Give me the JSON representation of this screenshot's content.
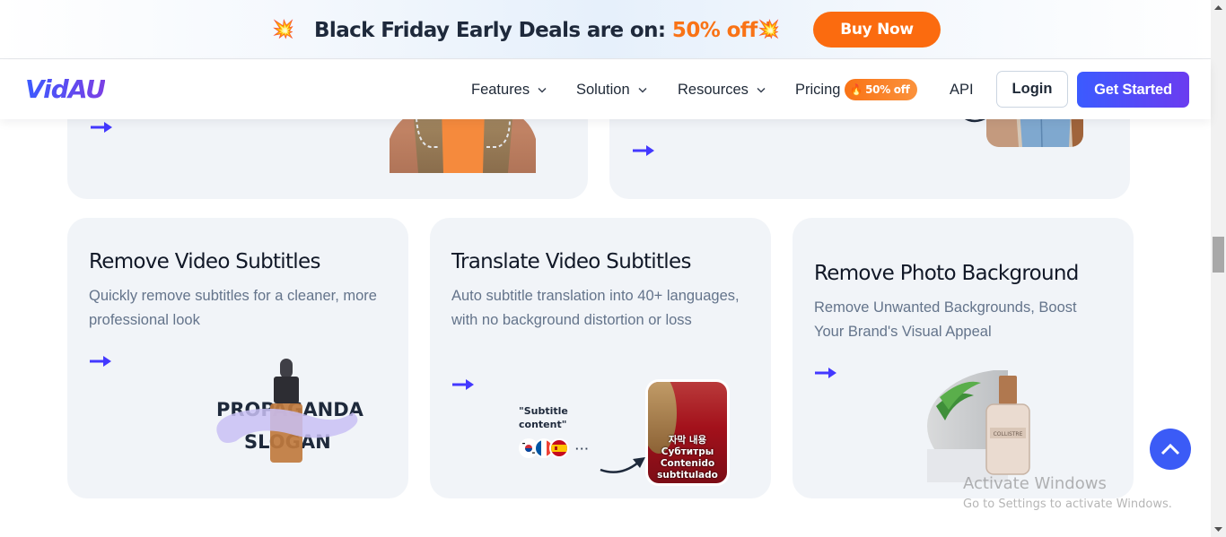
{
  "promo": {
    "icon": "collision-burst-icon",
    "headline": "Black Friday Early Deals are on: ",
    "headline_accent": "50% off !",
    "buy_button": "Buy Now",
    "accent_color": "#f97316",
    "button_color": "#fb6b0f"
  },
  "nav": {
    "logo": "VidAU",
    "items": [
      {
        "label": "Features",
        "has_dropdown": true
      },
      {
        "label": "Solution",
        "has_dropdown": true
      },
      {
        "label": "Resources",
        "has_dropdown": true
      },
      {
        "label": "Pricing",
        "badge": "50% off",
        "badge_icon": "flame-icon"
      },
      {
        "label": "API"
      }
    ],
    "login": "Login",
    "get_started": "Get Started",
    "brand_color": "#3b5bff"
  },
  "cards": {
    "top_left": {
      "arrow": "arrow-right-icon"
    },
    "top_right": {
      "arrow": "arrow-right-icon"
    },
    "remove_subtitles": {
      "title": "Remove Video Subtitles",
      "description": "Quickly remove subtitles for a cleaner, more professional look",
      "image_text_1": "PROPAGANDA",
      "image_text_2": "SLOGAN"
    },
    "translate_subtitles": {
      "title": "Translate Video Subtitles",
      "description": "Auto subtitle translation into 40+ languages, with no background distortion or loss",
      "quote": "\"Subtitle content\"",
      "flags": [
        "korea",
        "france",
        "spain"
      ],
      "more": "···",
      "translations": [
        "자막 내용",
        "Субтитры",
        "Contenido",
        "subtitulado"
      ]
    },
    "remove_photo_bg": {
      "title": "Remove Photo Background",
      "description": "Remove Unwanted Backgrounds, Boost Your Brand's Visual Appeal",
      "bottle_label": "COLLISTRE"
    }
  },
  "overlay": {
    "watermark_title": "Activate Windows",
    "watermark_subtitle": "Go to Settings to activate Windows."
  }
}
